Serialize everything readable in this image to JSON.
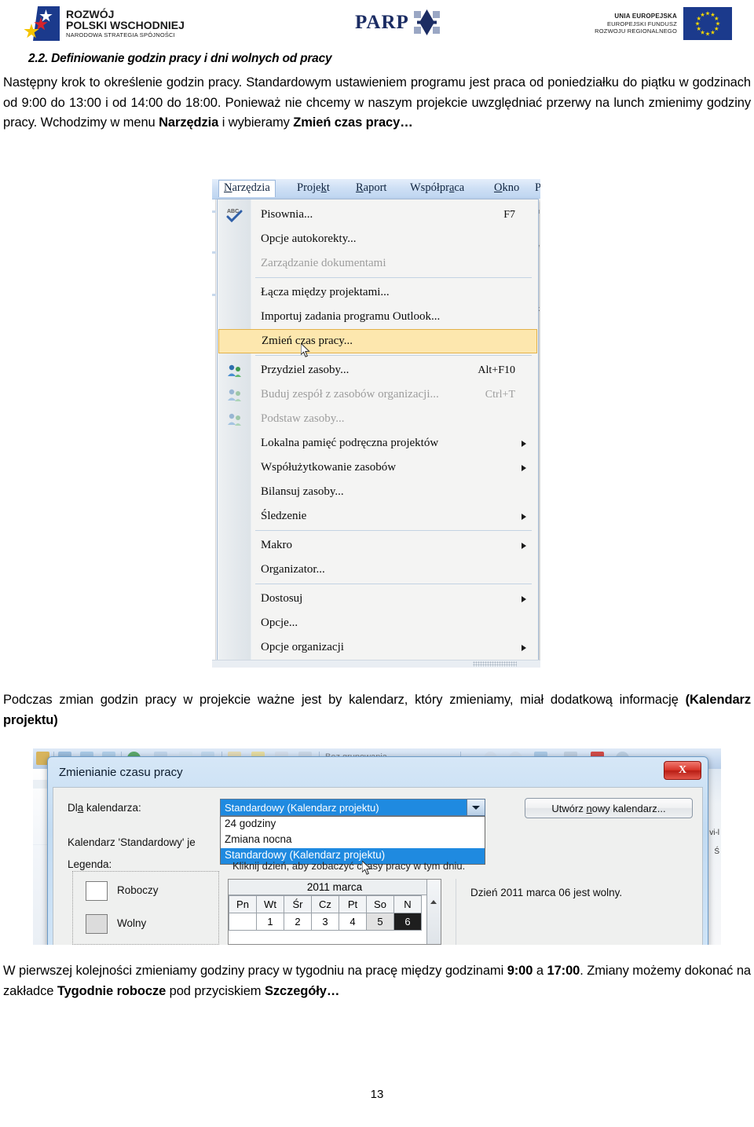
{
  "header": {
    "logo_rpw": {
      "line1": "ROZWÓJ",
      "line2": "POLSKI WSCHODNIEJ",
      "line3": "NARODOWA STRATEGIA SPÓJNOŚCI"
    },
    "logo_parp": {
      "wordmark": "PARP"
    },
    "logo_eu": {
      "line1": "UNIA EUROPEJSKA",
      "line2": "EUROPEJSKI FUNDUSZ",
      "line3": "ROZWOJU REGIONALNEGO"
    }
  },
  "document": {
    "heading": "2.2. Definiowanie godzin pracy i dni wolnych od pracy",
    "paragraph_1_html": "Następny krok to określenie godzin pracy. Standardowym ustawieniem programu jest praca od poniedziałku do piątku w godzinach od 9:00 do 13:00 i od 14:00 do 18:00. Ponieważ nie chcemy w naszym projekcie uwzględniać przerwy na lunch zmienimy godziny pracy. Wchodzimy w menu <b>Narzędzia</b> i wybieramy <b>Zmień czas pracy…</b>",
    "paragraph_2_html": "Podczas zmian godzin pracy w projekcie ważne jest by kalendarz, który zmieniamy, miał dodatkową informację <b>(Kalendarz projektu)</b>",
    "paragraph_3_html": "W pierwszej kolejności zmieniamy godziny pracy w tygodniu na pracę między godzinami <b>9:00</b> a <b>17:00</b>. Zmiany możemy dokonać na zakładce <b>Tygodnie robocze</b> pod przyciskiem <b>Szczegóły…</b>",
    "page_number": "13"
  },
  "screenshot_menu": {
    "menubar": [
      {
        "label_pre": "N",
        "label_post": "arzędzia",
        "active": true
      },
      {
        "label_pre": "Proje",
        "label_mid": "k",
        "label_post": "t",
        "active": false
      },
      {
        "label_pre": "R",
        "label_post": "aport",
        "active": false
      },
      {
        "label_pre": "Współpr",
        "label_mid": "a",
        "label_post": "ca",
        "active": false
      },
      {
        "label_pre": "O",
        "label_post": "kno",
        "active": false
      },
      {
        "label_pre": "P",
        "label_post": "",
        "active": false
      }
    ],
    "menubar_items_plain": [
      "Narzędzia",
      "Projekt",
      "Raport",
      "Współpraca",
      "Okno",
      "P"
    ],
    "items": [
      {
        "label": "Pisownia...",
        "accel": "F7",
        "icon": "spellcheck-icon",
        "disabled": false,
        "submenu": false,
        "highlight": false
      },
      {
        "label": "Opcje autokorekty...",
        "accel": "",
        "icon": "",
        "disabled": false,
        "submenu": false,
        "highlight": false
      },
      {
        "label": "Zarządzanie dokumentami",
        "accel": "",
        "icon": "",
        "disabled": true,
        "submenu": false,
        "highlight": false
      },
      {
        "label": "Łącza między projektami...",
        "accel": "",
        "icon": "",
        "disabled": false,
        "submenu": false,
        "highlight": false
      },
      {
        "label": "Importuj zadania programu Outlook...",
        "accel": "",
        "icon": "",
        "disabled": false,
        "submenu": false,
        "highlight": false
      },
      {
        "label": "Zmień czas pracy...",
        "accel": "",
        "icon": "",
        "disabled": false,
        "submenu": false,
        "highlight": true
      },
      {
        "label": "Przydziel zasoby...",
        "accel": "Alt+F10",
        "icon": "assign-resources-icon",
        "disabled": false,
        "submenu": false,
        "highlight": false
      },
      {
        "label": "Buduj zespół z zasobów organizacji...",
        "accel": "Ctrl+T",
        "icon": "build-team-icon",
        "disabled": true,
        "submenu": false,
        "highlight": false
      },
      {
        "label": "Podstaw zasoby...",
        "accel": "",
        "icon": "substitute-resources-icon",
        "disabled": true,
        "submenu": false,
        "highlight": false
      },
      {
        "label": "Lokalna pamięć podręczna projektów",
        "accel": "",
        "icon": "",
        "disabled": false,
        "submenu": true,
        "highlight": false
      },
      {
        "label": "Współużytkowanie zasobów",
        "accel": "",
        "icon": "",
        "disabled": false,
        "submenu": true,
        "highlight": false
      },
      {
        "label": "Bilansuj zasoby...",
        "accel": "",
        "icon": "",
        "disabled": false,
        "submenu": false,
        "highlight": false
      },
      {
        "label": "Śledzenie",
        "accel": "",
        "icon": "",
        "disabled": false,
        "submenu": true,
        "highlight": false
      },
      {
        "label": "Makro",
        "accel": "",
        "icon": "",
        "disabled": false,
        "submenu": true,
        "highlight": false
      },
      {
        "label": "Organizator...",
        "accel": "",
        "icon": "",
        "disabled": false,
        "submenu": false,
        "highlight": false
      },
      {
        "label": "Dostosuj",
        "accel": "",
        "icon": "",
        "disabled": false,
        "submenu": true,
        "highlight": false
      },
      {
        "label": "Opcje...",
        "accel": "",
        "icon": "",
        "disabled": false,
        "submenu": false,
        "highlight": false
      },
      {
        "label": "Opcje organizacji",
        "accel": "",
        "icon": "",
        "disabled": false,
        "submenu": true,
        "highlight": false
      }
    ]
  },
  "screenshot_dialog": {
    "toolbar_group_label": "Bez grupowania",
    "title": "Zmienianie czasu pracy",
    "close_label": "X",
    "field_calendar_label": "Dla kalendarza:",
    "combo_value": "Standardowy (Kalendarz projektu)",
    "combo_options": [
      "24 godziny",
      "Zmiana nocna",
      "Standardowy (Kalendarz projektu)"
    ],
    "combo_selected_index": 2,
    "create_calendar_button": "Utwórz nowy kalendarz...",
    "calendar_is_label": "Kalendarz 'Standardowy' je",
    "legend_label": "Legenda:",
    "legend_items": [
      {
        "label": "Roboczy",
        "swatch": "white"
      },
      {
        "label": "Wolny",
        "swatch": "gray"
      }
    ],
    "click_hint": "Kliknij dzień, aby zobaczyć czasy pracy w tym dniu.",
    "calendar": {
      "month_label": "2011 marca",
      "day_headers": [
        "Pn",
        "Wt",
        "Śr",
        "Cz",
        "Pt",
        "So",
        "N"
      ],
      "week_row": [
        "",
        "1",
        "2",
        "3",
        "4",
        "5",
        "6"
      ],
      "weekend_indexes": [
        5,
        6
      ],
      "selected_index": 6
    },
    "day_info": "Dzień 2011 marca 06 jest wolny.",
    "right_peek": [
      "vi-l",
      "Ś"
    ]
  },
  "colors": {
    "highlight_menu_item": "#fde7ae",
    "combo_selection_blue": "#1f8ae0",
    "dialog_chrome_blue": "#c2dbf2",
    "close_button_red": "#d8352a",
    "eu_blue": "#1b3a8c",
    "eu_star_yellow": "#f5d800",
    "parp_navy": "#1b2c63"
  }
}
